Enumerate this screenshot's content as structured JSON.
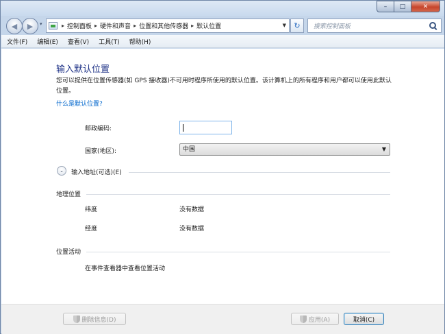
{
  "window": {
    "controls": {
      "minimize": "–",
      "maximize": "□",
      "close": "✕"
    }
  },
  "navigation": {
    "back_glyph": "◀",
    "forward_glyph": "▶",
    "recent_glyph": "▾",
    "breadcrumb": [
      "控制面板",
      "硬件和声音",
      "位置和其他传感器",
      "默认位置"
    ],
    "breadcrumb_separator": "▸",
    "refresh_glyph": "↻",
    "search_placeholder": "搜索控制面板",
    "icons": {
      "address": "control-panel-icon",
      "search": "magnifier-icon"
    }
  },
  "menu": [
    "文件(F)",
    "编辑(E)",
    "查看(V)",
    "工具(T)",
    "帮助(H)"
  ],
  "page": {
    "title": "输入默认位置",
    "description": "您可以提供在位置传感器(如 GPS 接收器)不可用时程序所使用的默认位置。该计算机上的所有程序和用户都可以使用此默认位置。",
    "what_link": "什么是默认位置?",
    "postal_label": "邮政编码:",
    "postal_value": "",
    "country_label": "国家(地区):",
    "country_value": "中国",
    "expand_glyph": "⌄",
    "address_expander": "输入地址(可选)(E)",
    "geo_section": "地理位置",
    "latitude_label": "纬度",
    "latitude_value": "没有数据",
    "longitude_label": "经度",
    "longitude_value": "没有数据",
    "activity_section": "位置活动",
    "activity_link": "在事件查看器中查看位置活动"
  },
  "footer": {
    "clear_button": "删除信息(D)",
    "apply_button": "应用(A)",
    "cancel_button": "取消(C)"
  }
}
